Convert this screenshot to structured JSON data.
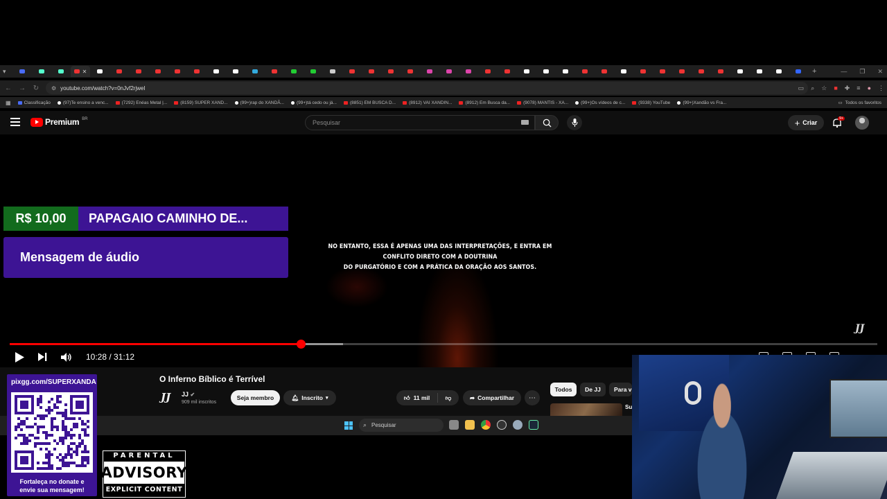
{
  "browser": {
    "url": "youtube.com/watch?v=0nJvf2rjweI",
    "bookmarks": [
      {
        "label": "Classificação",
        "kind": "sh"
      },
      {
        "label": "(97)Te ensino a venc...",
        "kind": "tt"
      },
      {
        "label": "(7292) Enéas Metal |...",
        "kind": "yt"
      },
      {
        "label": "(8159) SUPER XAND...",
        "kind": "yt"
      },
      {
        "label": "(99+)rap do XANDÃ...",
        "kind": "tt"
      },
      {
        "label": "(99+)tá cedo ou já...",
        "kind": "tt"
      },
      {
        "label": "(8851) EM BUSCA D...",
        "kind": "yt"
      },
      {
        "label": "(8912) VAI XANDIN...",
        "kind": "yt"
      },
      {
        "label": "(8912) Em Busca da...",
        "kind": "yt"
      },
      {
        "label": "(9078) MANTIS - XA...",
        "kind": "yt"
      },
      {
        "label": "(99+)Os vídeos de c...",
        "kind": "tt"
      },
      {
        "label": "(9338) YouTube",
        "kind": "yt"
      },
      {
        "label": "(99+)Xandão vs Fra...",
        "kind": "tt"
      }
    ],
    "all_bookmarks": "Todos os favoritos"
  },
  "youtube": {
    "logo": "Premium",
    "region": "BR",
    "search_placeholder": "Pesquisar",
    "create_label": "Criar",
    "notif_badge": "9+"
  },
  "video": {
    "subtitle_line1": "NO ENTANTO, ESSA É APENAS UMA DAS INTERPRETAÇÕES, E ENTRA EM CONFLITO DIRETO COM A DOUTRINA",
    "subtitle_line2": "DO PURGATÓRIO E COM A PRÁTICA DA ORAÇÃO AOS SANTOS.",
    "watermark": "JJ",
    "time_display": "10:28 / 31:12",
    "progress_fraction": 0.3356,
    "buffered_fraction": 0.384
  },
  "donation": {
    "amount": "R$ 10,00",
    "title": "PAPAGAIO CAMINHO DE...",
    "message": "Mensagem de áudio"
  },
  "watch": {
    "title": "O Inferno Bíblico é Terrível",
    "channel_logo": "JJ",
    "channel_name": "JJ",
    "subscribers": "909 mil inscritos",
    "member_label": "Seja membro",
    "subscribed_label": "Inscrito",
    "likes": "11 mil",
    "share_label": "Compartilhar",
    "chips": [
      "Todos",
      "De JJ",
      "Para v"
    ],
    "rec_title": "Su"
  },
  "taskbar": {
    "search_placeholder": "Pesquisar"
  },
  "overlay": {
    "pix_url": "pixgg.com/SUPERXANDA",
    "qr_caption_line1": "Fortaleça no donate e",
    "qr_caption_line2": "envie sua mensagem!",
    "advisory_top": "PARENTAL",
    "advisory_mid": "ADVISORY",
    "advisory_bottom": "EXPLICIT CONTENT"
  },
  "colors": {
    "donation_green": "#126b1d",
    "donation_purple": "#3d1494",
    "progress_red": "#ff0000"
  }
}
